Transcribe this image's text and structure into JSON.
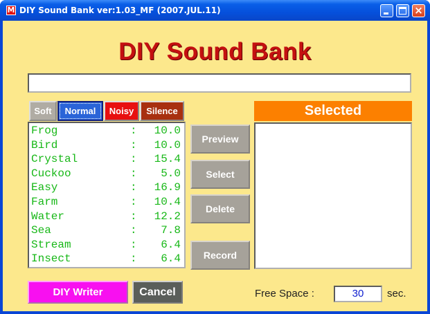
{
  "window": {
    "title": "DIY Sound Bank ver:1.03_MF (2007.JUL.11)",
    "app_icon_letter": "M",
    "controls": {
      "minimize": "minimize",
      "maximize": "maximize",
      "close": "×"
    }
  },
  "header": {
    "title": "DIY Sound Bank"
  },
  "name_input": {
    "value": "",
    "placeholder": ""
  },
  "modes": [
    {
      "label": "Soft"
    },
    {
      "label": "Normal",
      "selected": true
    },
    {
      "label": "Noisy"
    },
    {
      "label": "Silence"
    }
  ],
  "sounds": [
    {
      "name": "Frog",
      "sep": ":",
      "size": "10.0"
    },
    {
      "name": "Bird",
      "sep": ":",
      "size": "10.0"
    },
    {
      "name": "Crystal",
      "sep": ":",
      "size": "15.4"
    },
    {
      "name": "Cuckoo",
      "sep": ":",
      "size": "5.0"
    },
    {
      "name": "Easy",
      "sep": ":",
      "size": "16.9"
    },
    {
      "name": "Farm",
      "sep": ":",
      "size": "10.4"
    },
    {
      "name": "Water",
      "sep": ":",
      "size": "12.2"
    },
    {
      "name": "Sea",
      "sep": ":",
      "size": "7.8"
    },
    {
      "name": "Stream",
      "sep": ":",
      "size": "6.4"
    },
    {
      "name": "Insect",
      "sep": ":",
      "size": "6.4"
    }
  ],
  "actions": {
    "preview": "Preview",
    "select": "Select",
    "delete": "Delete",
    "record": "Record"
  },
  "selected_panel": {
    "header": "Selected",
    "items": []
  },
  "footer": {
    "diy_writer": "DIY Writer",
    "cancel": "Cancel",
    "free_space_label": "Free Space :",
    "free_space_value": "30",
    "free_space_unit": "sec."
  },
  "colors": {
    "background": "#fce88c",
    "title": "#c41010",
    "list_text": "#18b818",
    "selected_header": "#fc8000",
    "diy_button": "#f810f0"
  }
}
